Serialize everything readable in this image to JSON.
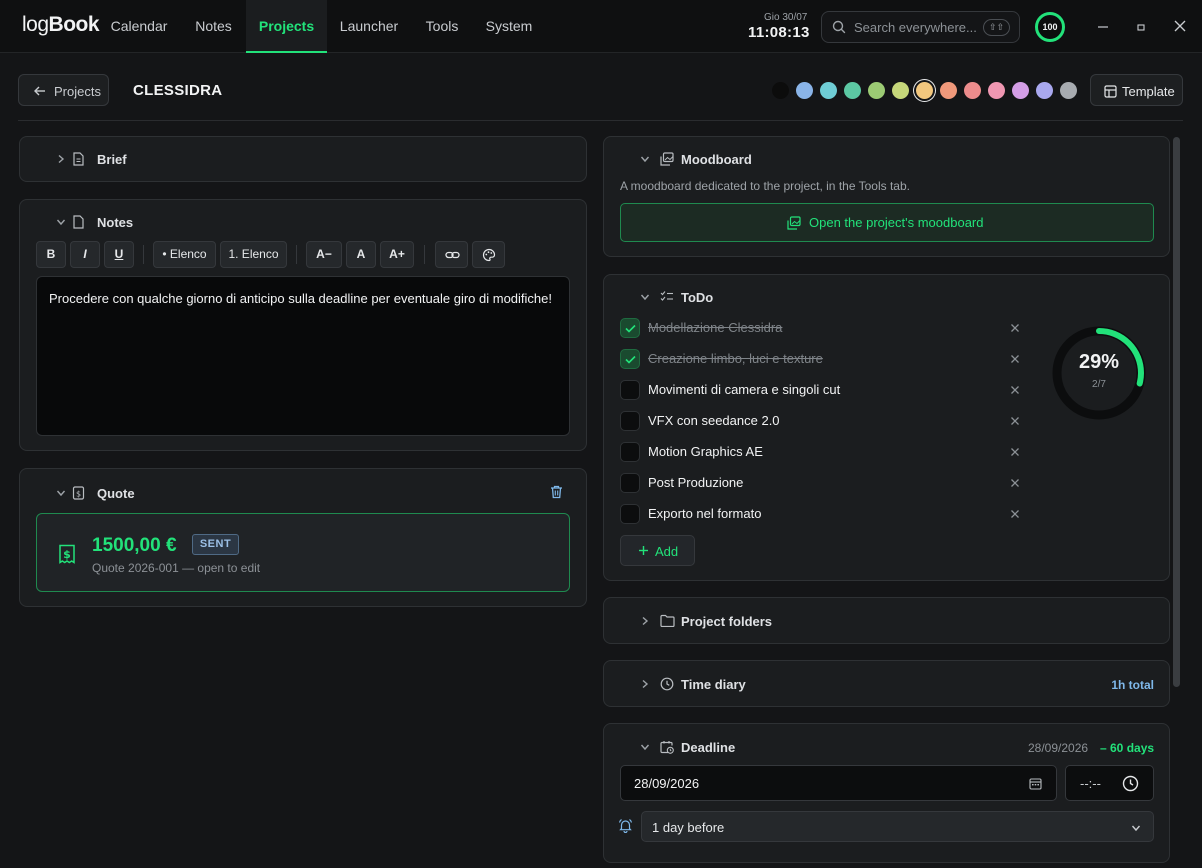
{
  "app": {
    "logo_light": "log",
    "logo_bold": "Book"
  },
  "nav": [
    {
      "label": "Calendar"
    },
    {
      "label": "Notes"
    },
    {
      "label": "Projects"
    },
    {
      "label": "Launcher"
    },
    {
      "label": "Tools"
    },
    {
      "label": "System"
    }
  ],
  "header": {
    "date": "Gio 30/07",
    "time": "11:08:13",
    "search_placeholder": "Search everywhere...",
    "search_shortcut": "⇧⇧",
    "score": "100"
  },
  "project": {
    "back_label": "Projects",
    "title": "CLESSIDRA",
    "template_label": "Template",
    "colors": [
      "#0c0c0c",
      "#8ab4e8",
      "#6fcdd5",
      "#5cc8a3",
      "#9ccb74",
      "#c6d77a",
      "#f2c77e",
      "#f0997b",
      "#ec8c8c",
      "#f097b2",
      "#d49ee6",
      "#a9a8ef",
      "#a7abb0"
    ],
    "selected_color": "#f2c77e"
  },
  "brief": {
    "title": "Brief"
  },
  "notes": {
    "title": "Notes",
    "toolbar": {
      "bold": "B",
      "italic": "I",
      "underline": "U",
      "bullet_list": "• Elenco",
      "numbered_list": "1. Elenco",
      "font_smaller": "A−",
      "font_default": "A",
      "font_bigger": "A+"
    },
    "content": "Procedere con qualche giorno di anticipo sulla deadline per eventuale giro di modifiche!"
  },
  "quote": {
    "title": "Quote",
    "amount": "1500,00 €",
    "status": "SENT",
    "subtitle": "Quote 2026-001 — open to edit"
  },
  "moodboard": {
    "title": "Moodboard",
    "description": "A moodboard dedicated to the project, in the Tools tab.",
    "button_label": "Open the project's moodboard"
  },
  "todo": {
    "title": "ToDo",
    "items": [
      {
        "label": "Modellazione Clessidra",
        "done": true
      },
      {
        "label": "Creazione limbo, luci e texture",
        "done": true
      },
      {
        "label": "Movimenti di camera e singoli cut",
        "done": false
      },
      {
        "label": "VFX con seedance 2.0",
        "done": false
      },
      {
        "label": "Motion Graphics AE",
        "done": false
      },
      {
        "label": "Post Produzione",
        "done": false
      },
      {
        "label": "Exporto nel formato",
        "done": false
      }
    ],
    "progress_percent": 29,
    "progress_label": "29%",
    "progress_count": "2/7",
    "add_label": "Add"
  },
  "project_folders": {
    "title": "Project folders"
  },
  "time_diary": {
    "title": "Time diary",
    "total": "1h total"
  },
  "deadline": {
    "title": "Deadline",
    "date_summary": "28/09/2026",
    "days_left": "– 60 days",
    "date_value": "28/09/2026",
    "time_value": "--:--",
    "reminder": "1 day before"
  },
  "colors": {
    "accent": "#22e27a",
    "background": "#141517",
    "card": "#1b1d1f",
    "info": "#7fb8ea"
  }
}
